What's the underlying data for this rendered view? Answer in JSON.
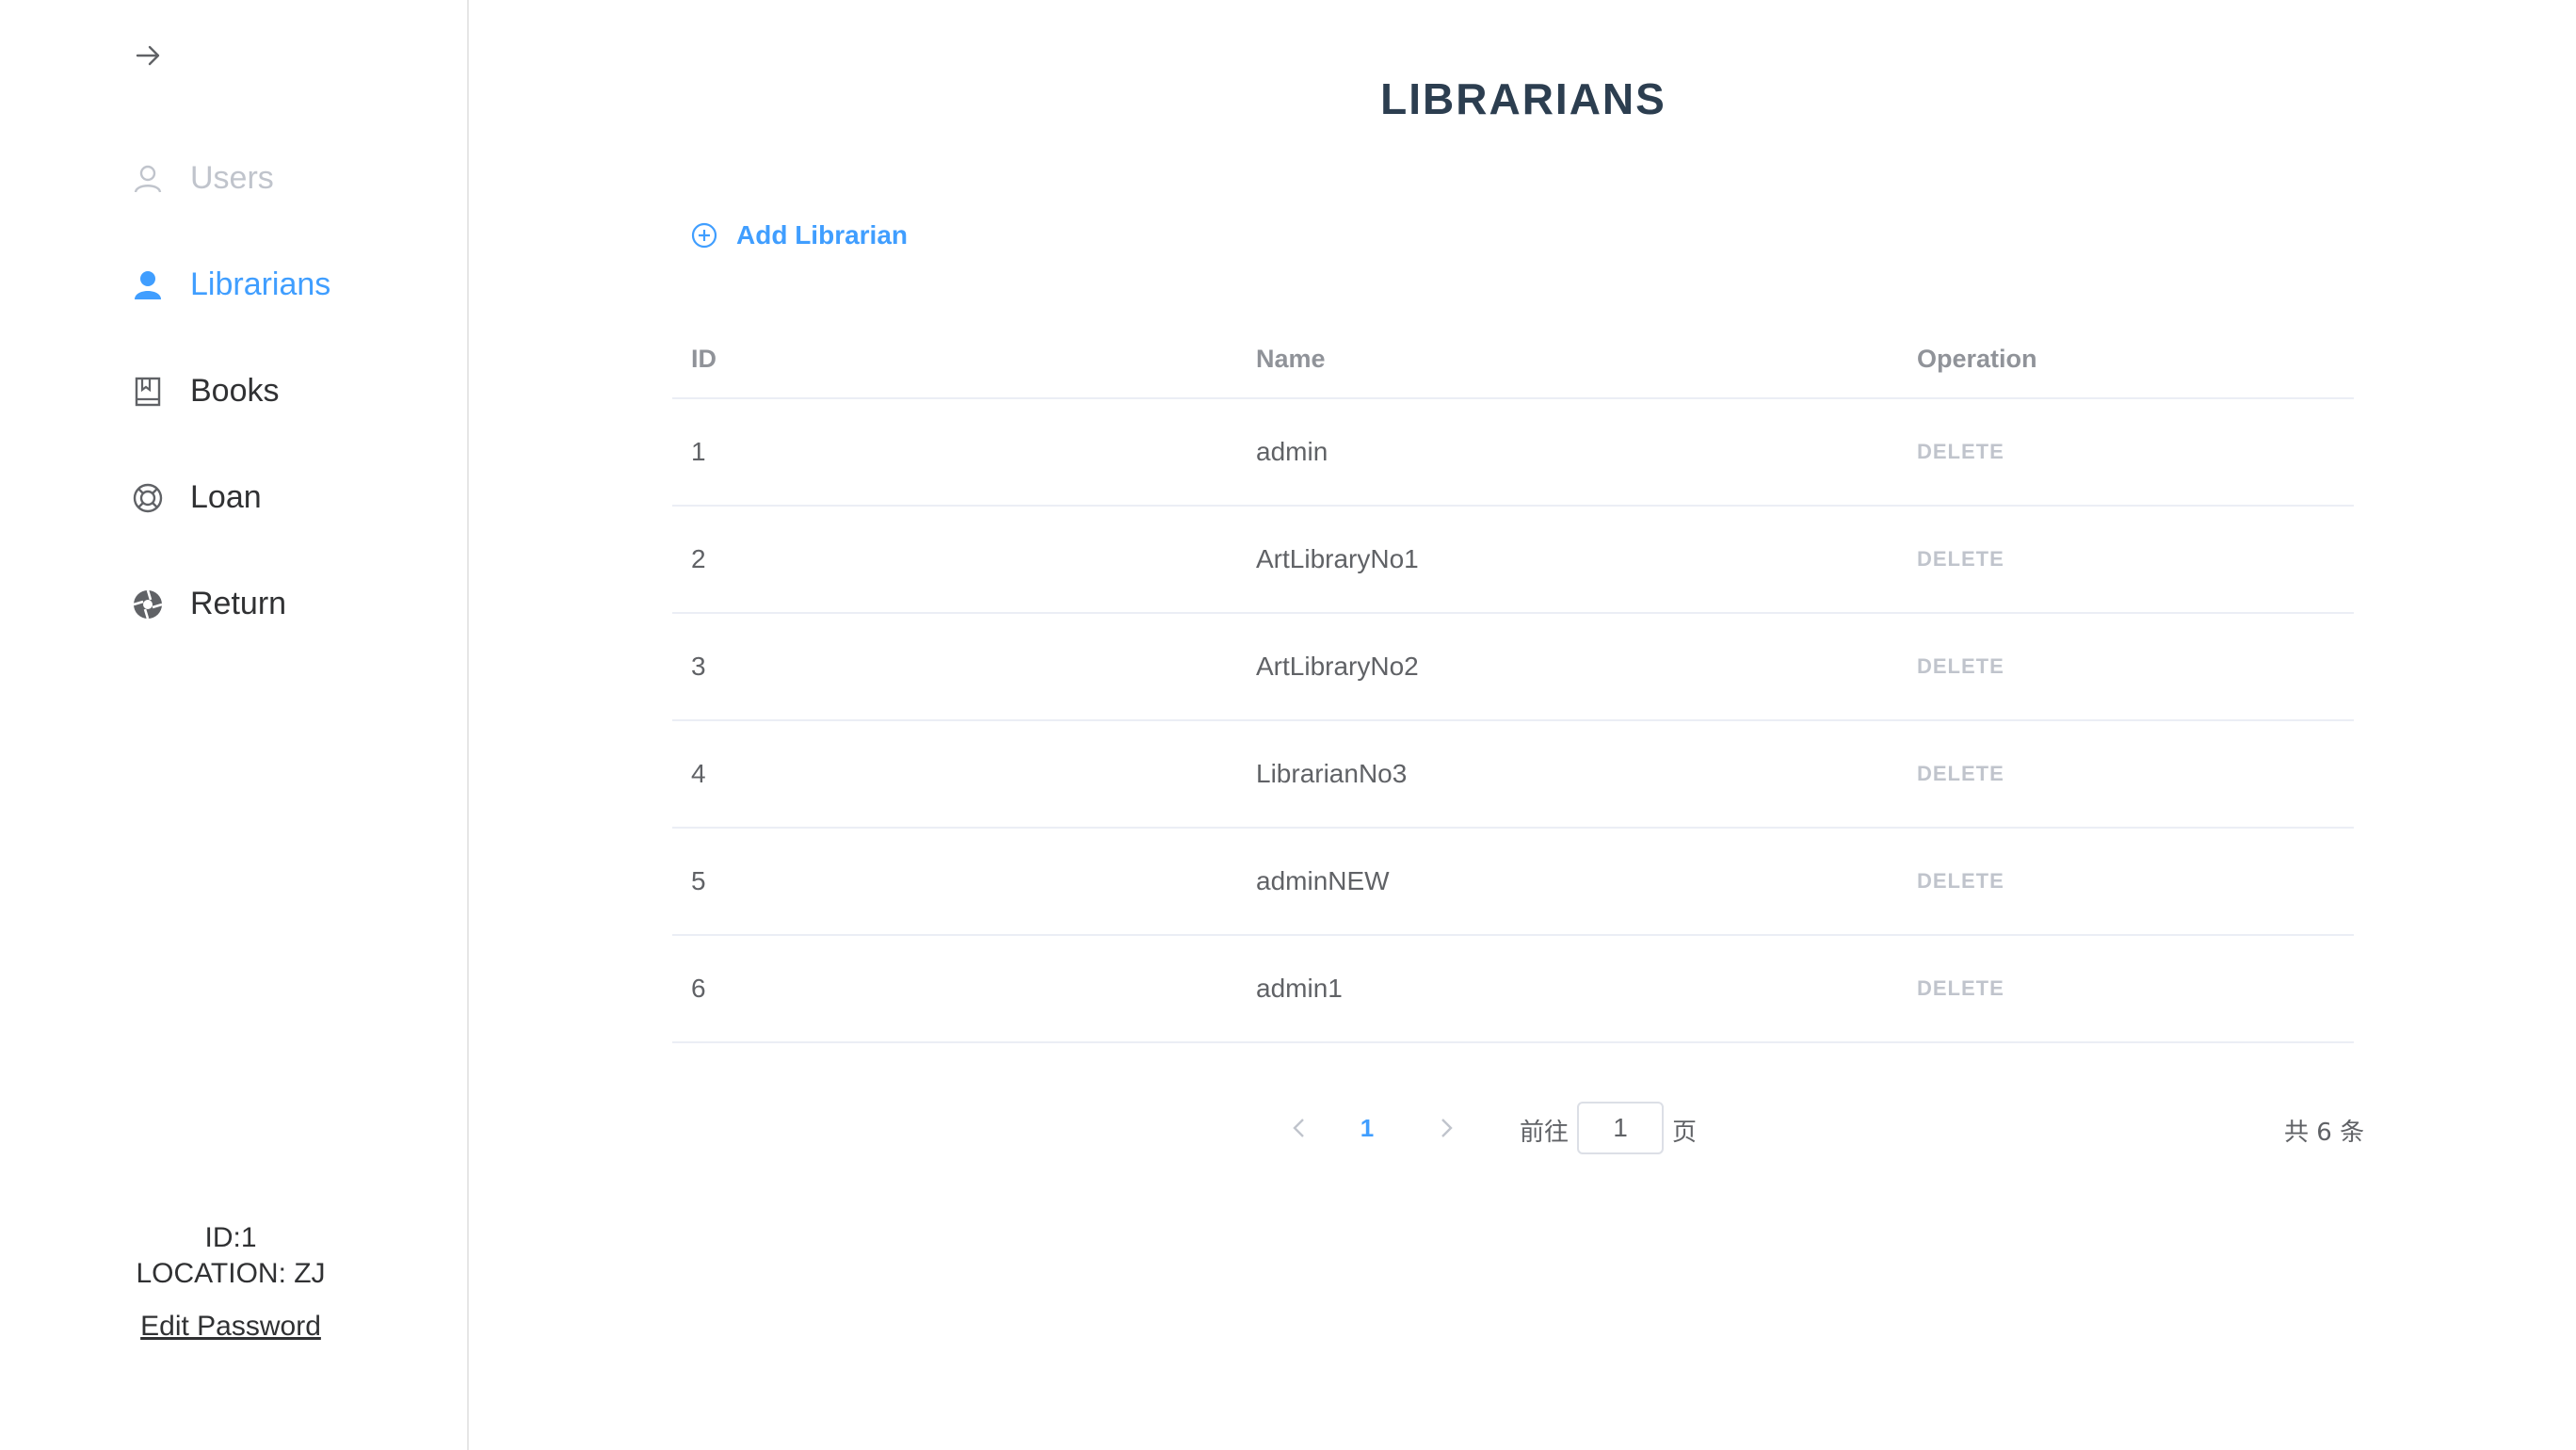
{
  "sidebar": {
    "toggle_icon": "arrow-right-icon",
    "items": [
      {
        "label": "Users",
        "icon": "user-icon",
        "state": "disabled"
      },
      {
        "label": "Librarians",
        "icon": "user-filled-icon",
        "state": "active"
      },
      {
        "label": "Books",
        "icon": "notebook-icon",
        "state": "normal"
      },
      {
        "label": "Loan",
        "icon": "lifebuoy-icon",
        "state": "normal"
      },
      {
        "label": "Return",
        "icon": "aperture-icon",
        "state": "normal"
      }
    ],
    "user_id": "ID:1",
    "location": "LOCATION: ZJ",
    "edit_password": "Edit Password"
  },
  "main": {
    "title": "LIBRARIANS",
    "add_button": "Add Librarian",
    "columns": {
      "id": "ID",
      "name": "Name",
      "operation": "Operation"
    },
    "rows": [
      {
        "id": "1",
        "name": "admin",
        "action": "DELETE"
      },
      {
        "id": "2",
        "name": "ArtLibraryNo1",
        "action": "DELETE"
      },
      {
        "id": "3",
        "name": "ArtLibraryNo2",
        "action": "DELETE"
      },
      {
        "id": "4",
        "name": "LibrarianNo3",
        "action": "DELETE"
      },
      {
        "id": "5",
        "name": "adminNEW",
        "action": "DELETE"
      },
      {
        "id": "6",
        "name": "admin1",
        "action": "DELETE"
      }
    ]
  },
  "pagination": {
    "current_page": "1",
    "goto_label": "前往",
    "goto_value": "1",
    "page_unit": "页",
    "total": "共 6 条"
  },
  "colors": {
    "accent": "#409eff",
    "muted": "#c0c4cc",
    "title": "#2c3e50"
  }
}
